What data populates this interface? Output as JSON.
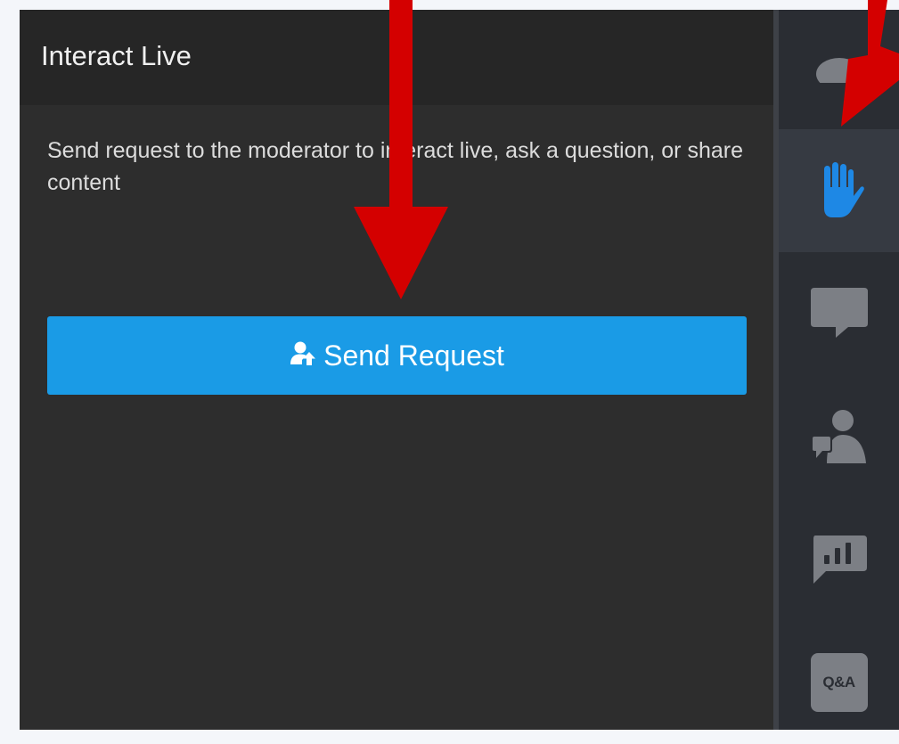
{
  "panel": {
    "title": "Interact Live",
    "description": "Send request to the moderator to interact live, ask a question, or share content",
    "send_button_label": "Send Request",
    "send_button_icon": "user-upload-icon"
  },
  "rail": {
    "items": [
      {
        "icon": "participants-icon",
        "active": false
      },
      {
        "icon": "raise-hand-icon",
        "active": true
      },
      {
        "icon": "chat-icon",
        "active": false
      },
      {
        "icon": "ask-expert-icon",
        "active": false
      },
      {
        "icon": "poll-icon",
        "active": false
      },
      {
        "icon": "qa-icon",
        "label": "Q&A",
        "active": false
      }
    ]
  },
  "colors": {
    "panel_background": "#2d2d2d",
    "header_background": "#262626",
    "button_blue": "#1a9be6",
    "active_icon_blue": "#1e88e5",
    "rail_background": "#2a2d33",
    "icon_gray": "#7c7f85",
    "annotation_red": "#d40000"
  }
}
